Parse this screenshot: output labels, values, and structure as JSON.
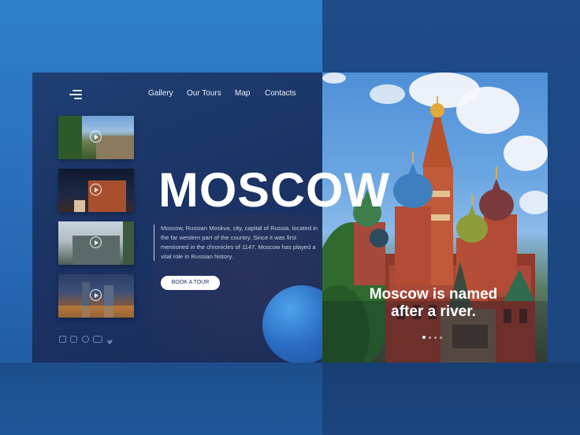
{
  "nav": {
    "items": [
      {
        "label": "Gallery"
      },
      {
        "label": "Our Tours"
      },
      {
        "label": "Map"
      },
      {
        "label": "Contacts"
      }
    ]
  },
  "hero": {
    "title": "MOSCOW",
    "description": "Moscow, Russian Moskva, city, capital of Russia, located in the far western part of the country. Since it was first mentioned in the chronicles of 1147, Moscow has played a vital role in Russian history.",
    "cta_label": "BOOK A TOUR",
    "caption_line1": "Moscow is named",
    "caption_line2": "after a river."
  },
  "gallery": {
    "thumbnails": [
      {
        "icon": "play-icon"
      },
      {
        "icon": "play-icon"
      },
      {
        "icon": "play-icon"
      },
      {
        "icon": "play-icon"
      }
    ]
  },
  "social": {
    "icons": [
      "facebook-icon",
      "instagram-icon",
      "camera-icon",
      "youtube-icon",
      "twitter-icon"
    ]
  },
  "slider": {
    "dots": 4,
    "active_index": 0
  },
  "colors": {
    "page_bg": "#2f7fcb",
    "card_bg": "#1b3466",
    "accent_orb": "#2a6cc4",
    "button_bg": "#ffffff",
    "text_light": "#e8eef8"
  }
}
